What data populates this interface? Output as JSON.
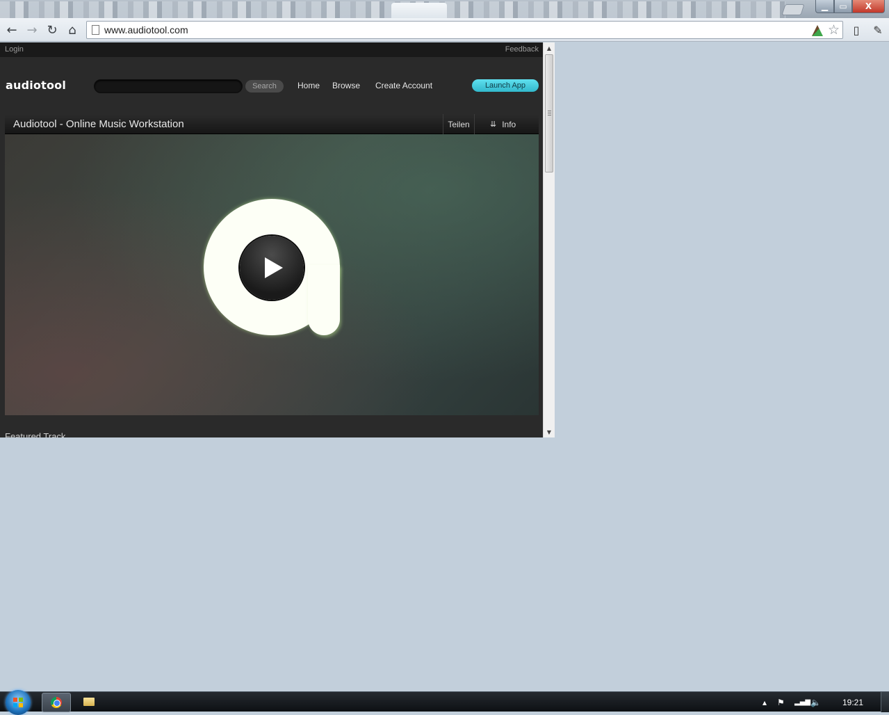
{
  "browser": {
    "url": "www.audiotool.com",
    "window_controls": {
      "minimize": "▁",
      "maximize": "▭",
      "close": "X"
    },
    "icons": {
      "back": "back-arrow-icon",
      "forward": "forward-arrow-icon",
      "reload": "reload-icon",
      "home": "home-icon",
      "page": "page-icon",
      "extension": "extension-icon",
      "bookmark": "star-icon",
      "sync": "sync-icon",
      "wrench": "wrench-icon"
    }
  },
  "site": {
    "topbar": {
      "login": "Login",
      "feedback": "Feedback"
    },
    "logo": "audiotool",
    "search": {
      "placeholder": "",
      "button": "Search"
    },
    "nav": {
      "home": "Home",
      "browse": "Browse",
      "create_account": "Create Account"
    },
    "launch_app": "Launch App",
    "video": {
      "title": "Audiotool - Online Music Workstation",
      "share": "Teilen",
      "info": "Info"
    },
    "featured_heading": "Featured Track"
  },
  "taskbar": {
    "clock": "19:21",
    "tray_icons": [
      "show-hidden-icons-icon",
      "action-center-flag-icon",
      "network-icon",
      "volume-icon"
    ]
  },
  "colors": {
    "launch_app_bg": "#3fc9dc",
    "desktop_bg": "#c2cfdb",
    "page_bg": "#2a2a2a",
    "close_button": "#c7402f"
  }
}
